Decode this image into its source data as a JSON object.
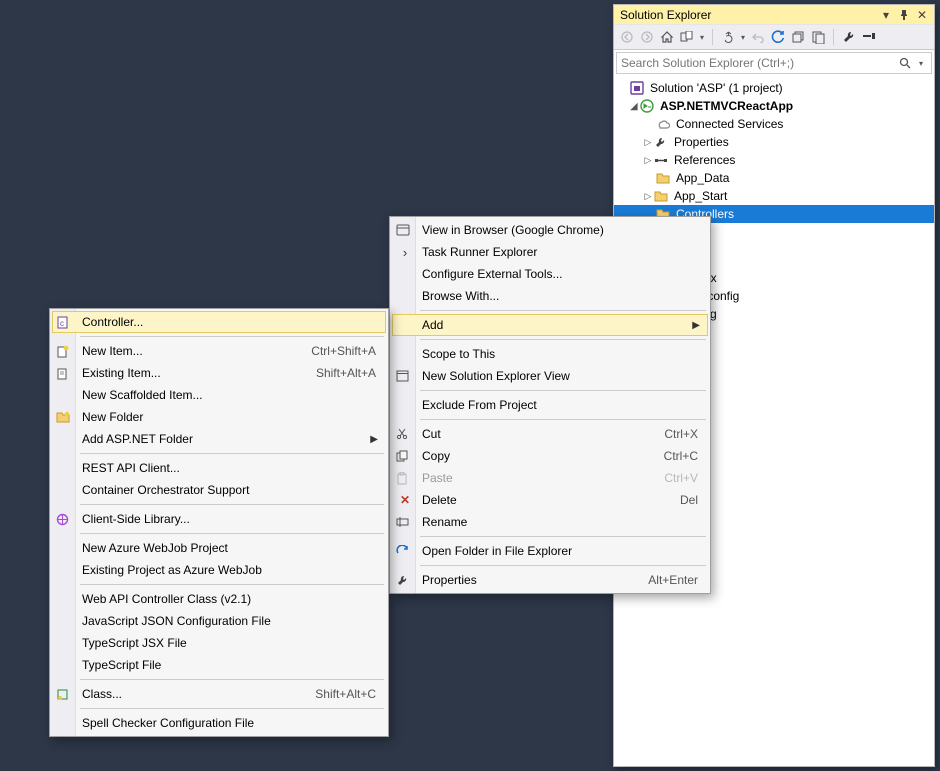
{
  "se": {
    "title": "Solution Explorer",
    "searchPlaceholder": "Search Solution Explorer (Ctrl+;)",
    "solutionLabel": "Solution 'ASP' (1 project)",
    "project": "ASP.NETMVCReactApp",
    "nodes": {
      "connected": "Connected Services",
      "properties": "Properties",
      "references": "References",
      "appData": "App_Data",
      "appStart": "App_Start",
      "controllers": "Controllers",
      "peek1": "ax",
      "peek2": ".config",
      "peek3": "fig"
    }
  },
  "ctx1": {
    "viewInBrowser": "View in Browser (Google Chrome)",
    "taskRunner": "Task Runner Explorer",
    "configTools": "Configure External Tools...",
    "browseWith": "Browse With...",
    "add": "Add",
    "scope": "Scope to This",
    "newSEView": "New Solution Explorer View",
    "exclude": "Exclude From Project",
    "cut": "Cut",
    "cutSc": "Ctrl+X",
    "copy": "Copy",
    "copySc": "Ctrl+C",
    "paste": "Paste",
    "pasteSc": "Ctrl+V",
    "delete": "Delete",
    "deleteSc": "Del",
    "rename": "Rename",
    "openExplorer": "Open Folder in File Explorer",
    "properties": "Properties",
    "propertiesSc": "Alt+Enter"
  },
  "ctx2": {
    "controller": "Controller...",
    "newItem": "New Item...",
    "newItemSc": "Ctrl+Shift+A",
    "existingItem": "Existing Item...",
    "existingItemSc": "Shift+Alt+A",
    "scaffolded": "New Scaffolded Item...",
    "newFolder": "New Folder",
    "aspFolder": "Add ASP.NET Folder",
    "restApi": "REST API Client...",
    "containerOrch": "Container Orchestrator Support",
    "clientLib": "Client-Side Library...",
    "newAzure": "New Azure WebJob Project",
    "existAzure": "Existing Project as Azure WebJob",
    "webApiCtrl": "Web API Controller Class (v2.1)",
    "jsJsonCfg": "JavaScript JSON Configuration File",
    "tsxFile": "TypeScript JSX File",
    "tsFile": "TypeScript File",
    "class": "Class...",
    "classSc": "Shift+Alt+C",
    "spellCfg": "Spell Checker Configuration File"
  }
}
